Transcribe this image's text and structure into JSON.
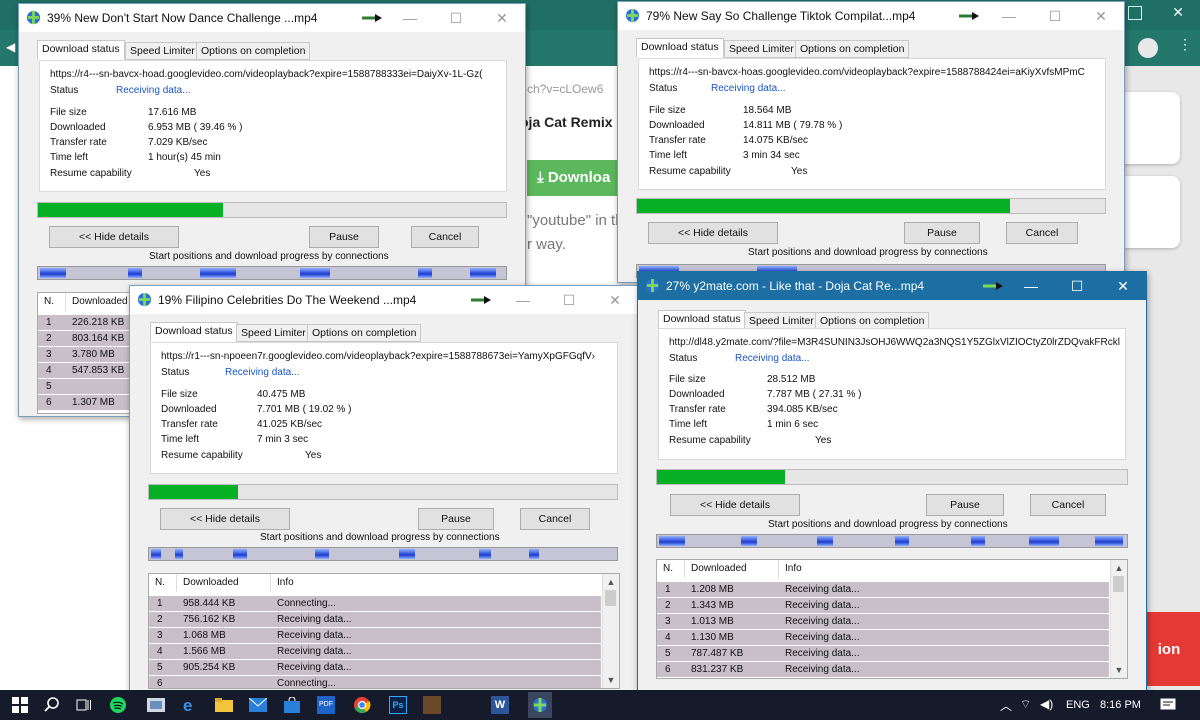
{
  "background": {
    "snippet_url": "ch?v=cLOew6",
    "heading": "oja Cat Remix",
    "download_label": "Downloa",
    "hint_line1": "\"youtube\" in th",
    "hint_line2": "r way.",
    "red_button_label": "ion"
  },
  "win1": {
    "title": "39% New Don't Start Now Dance Challenge ...mp4",
    "tabs": [
      "Download status",
      "Speed Limiter",
      "Options on completion"
    ],
    "url": "https://r4---sn-bavcx-hoad.googlevideo.com/videoplayback?expire=1588788333ei=DaiyXv-1L-Gz(",
    "status_label": "Status",
    "status_value": "Receiving data...",
    "file_size_label": "File size",
    "file_size": "17.616  MB",
    "downloaded_label": "Downloaded",
    "downloaded": "6.953  MB  ( 39.46 % )",
    "rate_label": "Transfer rate",
    "rate": "7.029  KB/sec",
    "time_label": "Time left",
    "time": "1 hour(s) 45 min",
    "resume_label": "Resume capability",
    "resume": "Yes",
    "progress": 0.3946,
    "hide_details": "<< Hide details",
    "pause": "Pause",
    "cancel": "Cancel",
    "conn_caption": "Start positions and download progress by connections",
    "list_header_n": "N.",
    "list_header_dl": "Downloaded",
    "rows": [
      {
        "n": "1",
        "dl": "226.218  KB"
      },
      {
        "n": "2",
        "dl": "803.164  KB"
      },
      {
        "n": "3",
        "dl": "3.780  MB"
      },
      {
        "n": "4",
        "dl": "547.853  KB"
      },
      {
        "n": "5",
        "dl": ""
      },
      {
        "n": "6",
        "dl": "1.307  MB"
      }
    ]
  },
  "win2": {
    "title": "79% New Say So Challenge Tiktok Compilat...mp4",
    "tabs": [
      "Download status",
      "Speed Limiter",
      "Options on completion"
    ],
    "url": "https://r4---sn-bavcx-hoas.googlevideo.com/videoplayback?expire=1588788424ei=aKiyXvfsMPmC",
    "status_label": "Status",
    "status_value": "Receiving data...",
    "file_size_label": "File size",
    "file_size": "18.564  MB",
    "downloaded_label": "Downloaded",
    "downloaded": "14.811  MB  ( 79.78 % )",
    "rate_label": "Transfer rate",
    "rate": "14.075  KB/sec",
    "time_label": "Time left",
    "time": "3 min 34 sec",
    "resume_label": "Resume capability",
    "resume": "Yes",
    "progress": 0.7978,
    "hide_details": "<< Hide details",
    "pause": "Pause",
    "cancel": "Cancel",
    "conn_caption": "Start positions and download progress by connections"
  },
  "win3": {
    "title": "19% Filipino Celebrities Do The Weekend ...mp4",
    "tabs": [
      "Download status",
      "Speed Limiter",
      "Options on completion"
    ],
    "url": "https://r1---sn-npoeen7r.googlevideo.com/videoplayback?expire=1588788673ei=YamyXpGFGqfV›",
    "status_label": "Status",
    "status_value": "Receiving data...",
    "file_size_label": "File size",
    "file_size": "40.475  MB",
    "downloaded_label": "Downloaded",
    "downloaded": "7.701  MB  ( 19.02 % )",
    "rate_label": "Transfer rate",
    "rate": "41.025  KB/sec",
    "time_label": "Time left",
    "time": "7 min 3 sec",
    "resume_label": "Resume capability",
    "resume": "Yes",
    "progress": 0.1902,
    "hide_details": "<< Hide details",
    "pause": "Pause",
    "cancel": "Cancel",
    "conn_caption": "Start positions and download progress by connections",
    "list_header_n": "N.",
    "list_header_dl": "Downloaded",
    "list_header_info": "Info",
    "rows": [
      {
        "n": "1",
        "dl": "958.444  KB",
        "info": "Connecting..."
      },
      {
        "n": "2",
        "dl": "756.162  KB",
        "info": "Receiving data..."
      },
      {
        "n": "3",
        "dl": "1.068  MB",
        "info": "Receiving data..."
      },
      {
        "n": "4",
        "dl": "1.566  MB",
        "info": "Receiving data..."
      },
      {
        "n": "5",
        "dl": "905.254  KB",
        "info": "Receiving data..."
      },
      {
        "n": "6",
        "dl": "",
        "info": "Connecting..."
      }
    ]
  },
  "win4": {
    "title": "27% y2mate.com - Like that - Doja Cat Re...mp4",
    "tabs": [
      "Download status",
      "Speed Limiter",
      "Options on completion"
    ],
    "url": "http://dl48.y2mate.com/?file=M3R4SUNIN3JsOHJ6WWQ2a3NQS1Y5ZGlxVlZIOCtyZ0lrZDQvakFRckl",
    "status_label": "Status",
    "status_value": "Receiving data...",
    "file_size_label": "File size",
    "file_size": "28.512  MB",
    "downloaded_label": "Downloaded",
    "downloaded": "7.787  MB  ( 27.31 % )",
    "rate_label": "Transfer rate",
    "rate": "394.085  KB/sec",
    "time_label": "Time left",
    "time": "1 min 6 sec",
    "resume_label": "Resume capability",
    "resume": "Yes",
    "progress": 0.2731,
    "hide_details": "<< Hide details",
    "pause": "Pause",
    "cancel": "Cancel",
    "conn_caption": "Start positions and download progress by connections",
    "list_header_n": "N.",
    "list_header_dl": "Downloaded",
    "list_header_info": "Info",
    "rows": [
      {
        "n": "1",
        "dl": "1.208  MB",
        "info": "Receiving data..."
      },
      {
        "n": "2",
        "dl": "1.343  MB",
        "info": "Receiving data..."
      },
      {
        "n": "3",
        "dl": "1.013  MB",
        "info": "Receiving data..."
      },
      {
        "n": "4",
        "dl": "1.130  MB",
        "info": "Receiving data..."
      },
      {
        "n": "5",
        "dl": "787.487  KB",
        "info": "Receiving data..."
      },
      {
        "n": "6",
        "dl": "831.237  KB",
        "info": "Receiving data..."
      }
    ]
  },
  "taskbar": {
    "pdf_label": "PDF",
    "ps_label": "Ps",
    "word_label": "W",
    "lang": "ENG",
    "time": "8:16 PM"
  },
  "colors": {
    "progress": "#06b025",
    "accent": "#1d6fa3",
    "list_row": "#c8bfc8"
  }
}
